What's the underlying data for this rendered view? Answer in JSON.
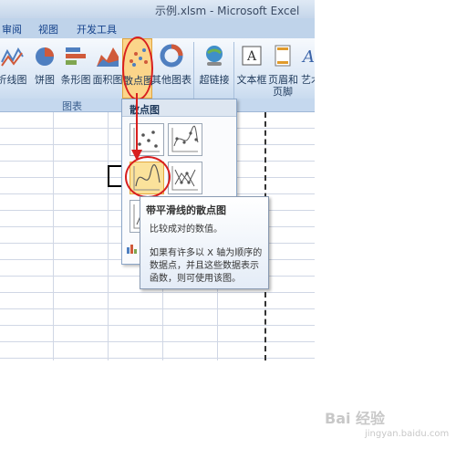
{
  "window": {
    "title": "示例.xlsm - Microsoft Excel"
  },
  "tabs": [
    {
      "label": "审阅"
    },
    {
      "label": "视图"
    },
    {
      "label": "开发工具"
    }
  ],
  "ribbon": {
    "buttons": [
      {
        "label": "折线图",
        "icon": "line-chart-icon"
      },
      {
        "label": "饼图",
        "icon": "pie-chart-icon"
      },
      {
        "label": "条形图",
        "icon": "bar-chart-icon"
      },
      {
        "label": "面积图",
        "icon": "area-chart-icon"
      },
      {
        "label": "散点图",
        "icon": "scatter-chart-icon"
      },
      {
        "label": "其他图表",
        "icon": "other-charts-icon"
      },
      {
        "label": "超链接",
        "icon": "hyperlink-icon"
      },
      {
        "label": "文本框",
        "icon": "textbox-icon"
      },
      {
        "label": "页眉和",
        "label2": "页脚",
        "icon": "header-footer-icon"
      },
      {
        "label": "艺术",
        "icon": "wordart-icon"
      }
    ],
    "group_label": "图表"
  },
  "scatter_menu": {
    "header": "散点图",
    "thumbnails": [
      {
        "name": "scatter-markers-only",
        "icon": "scatter-markers-icon"
      },
      {
        "name": "scatter-smooth-lines-markers",
        "icon": "scatter-smooth-markers-icon"
      },
      {
        "name": "scatter-smooth-lines",
        "icon": "scatter-smooth-icon",
        "selected": true
      },
      {
        "name": "scatter-straight-lines-markers",
        "icon": "scatter-straight-markers-icon"
      },
      {
        "name": "scatter-straight-lines",
        "icon": "scatter-straight-icon"
      }
    ],
    "all_chart_types_icon": "all-chart-types-icon"
  },
  "tooltip": {
    "title": "带平滑线的散点图",
    "line1": "比较成对的数值。",
    "line2": "如果有许多以 X 轴为顺序的",
    "line3": "数据点，并且这些数据表示",
    "line4": "函数，则可使用该图。"
  },
  "watermark": {
    "main": "Bai 经验",
    "sub": "jingyan.baidu.com"
  },
  "colors": {
    "highlight_red": "#d81f1f",
    "ribbon_blue": "#dbe7f5",
    "selected_gold": "#fbe29b"
  }
}
